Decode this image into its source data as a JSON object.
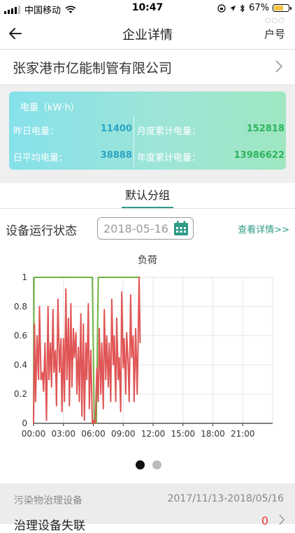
{
  "status_bar": {
    "carrier": "中国移动",
    "time": "10:47",
    "battery": "67%",
    "battery_level": 0.67
  },
  "nav": {
    "title": "企业详情",
    "right_label": "户号",
    "more_dots": "○○○"
  },
  "company": {
    "name": "张家港市亿能制管有限公司"
  },
  "energy_card": {
    "unit_label": "电量（kW·h）",
    "yesterday_label": "昨日电量：",
    "yesterday_value": "11400",
    "month_label": "月度累计电量：",
    "month_value": "152818",
    "daily_avg_label": "日平均电量：",
    "daily_avg_value": "38888",
    "year_label": "年度累计电量：",
    "year_value": "13986622"
  },
  "group_tab": {
    "label": "默认分组"
  },
  "device_status": {
    "title": "设备运行状态",
    "date": "2018-05-16",
    "detail_link": "查看详情>>"
  },
  "chart_data": {
    "type": "line",
    "title": "负荷",
    "x_ticks": [
      "00:00",
      "03:00",
      "06:00",
      "09:00",
      "12:00",
      "15:00",
      "18:00",
      "21:00"
    ],
    "y_ticks": [
      "0",
      "0.2",
      "0.4",
      "0.6",
      "0.8",
      "1"
    ],
    "xlim": [
      0,
      24
    ],
    "ylim": [
      0,
      1
    ],
    "grid": true,
    "series": [
      {
        "color": "#6db33f",
        "x": [
          0,
          0.05,
          5.9,
          6.1,
          6.3,
          6.5,
          10.7
        ],
        "values": [
          0,
          1,
          1,
          0,
          0,
          1,
          1
        ]
      },
      {
        "color": "#e05555",
        "x": [
          0,
          0.1,
          0.2,
          0.35,
          0.5,
          0.6,
          0.75,
          0.9,
          1.0,
          1.15,
          1.3,
          1.45,
          1.55,
          1.7,
          1.8,
          1.95,
          2.05,
          2.2,
          2.3,
          2.45,
          2.6,
          2.75,
          2.85,
          3.0,
          3.1,
          3.25,
          3.35,
          3.5,
          3.6,
          3.75,
          3.85,
          4.0,
          4.1,
          4.25,
          4.35,
          4.5,
          4.6,
          4.75,
          4.85,
          5.0,
          5.1,
          5.25,
          5.35,
          5.5,
          5.6,
          5.75,
          5.9,
          6.05,
          6.2,
          6.35,
          6.5,
          6.6,
          6.75,
          6.85,
          7.0,
          7.1,
          7.25,
          7.35,
          7.5,
          7.6,
          7.75,
          7.85,
          8.0,
          8.1,
          8.25,
          8.35,
          8.5,
          8.6,
          8.75,
          8.85,
          9.0,
          9.1,
          9.25,
          9.35,
          9.5,
          9.6,
          9.75,
          9.85,
          10.0,
          10.1,
          10.25,
          10.4,
          10.5,
          10.6,
          10.7
        ],
        "values": [
          0,
          0.68,
          0.15,
          0.6,
          0.3,
          0.8,
          0.3,
          0.35,
          0.22,
          0.55,
          0.02,
          0.8,
          0.3,
          0.55,
          0.25,
          0.78,
          0.35,
          0.5,
          0.12,
          0.85,
          0.35,
          0.58,
          0.08,
          0.58,
          0.15,
          0.92,
          0.3,
          0.72,
          0.12,
          0.82,
          0.25,
          0.65,
          0.45,
          0.62,
          0.2,
          0.52,
          0.15,
          0.75,
          0.05,
          0.68,
          0.02,
          0.55,
          0.3,
          0.82,
          0.1,
          0.5,
          0.0,
          0.02,
          0.0,
          0.38,
          0.15,
          0.65,
          0.2,
          0.55,
          0.1,
          0.78,
          0.3,
          0.6,
          0.25,
          0.55,
          0.15,
          0.85,
          0.4,
          0.6,
          0.15,
          0.72,
          0.3,
          0.45,
          0.08,
          0.9,
          0.38,
          0.58,
          0.2,
          0.62,
          0.4,
          0.15,
          0.88,
          0.45,
          0.6,
          0.15,
          0.65,
          0.2,
          0.55,
          1.0,
          0.55
        ]
      }
    ]
  },
  "pager": {
    "count": 2,
    "active": 0
  },
  "footer": {
    "left": "污染物治理设备",
    "right": "2017/11/13-2018/05/16",
    "next_label": "治理设备失联",
    "next_badge": "0"
  }
}
